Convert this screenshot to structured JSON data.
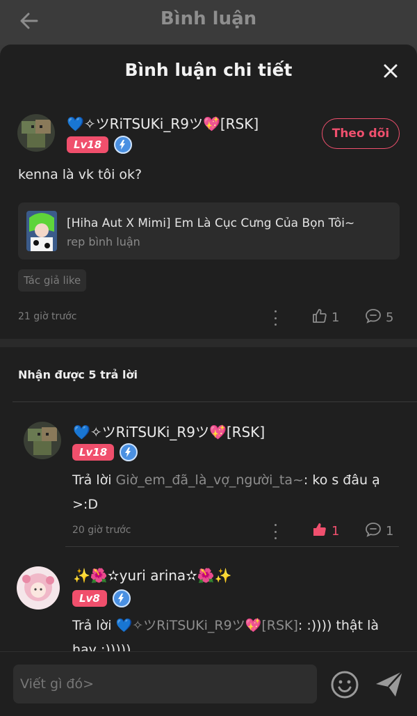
{
  "header": {
    "title": "Bình luận"
  },
  "sheet": {
    "title": "Bình luận chi tiết"
  },
  "comment": {
    "username": "💙✧ツRiTSUKi_R9ツ💖[RSK]",
    "level": "Lv18",
    "follow_label": "Theo dõi",
    "text": "kenna là vk tôi ok?",
    "ref": {
      "title": "[Hiha Aut X Mimi] Em Là Cục Cưng Của Bọn Tôi~",
      "subtitle": "rep bình luận"
    },
    "tag": "Tác giả like",
    "time": "21 giờ trước",
    "likes": "1",
    "comments": "5"
  },
  "replies_header": "Nhận được 5 trả lời",
  "replies": [
    {
      "username": "💙✧ツRiTSUKi_R9ツ💖[RSK]",
      "level": "Lv18",
      "prefix": "Trả lời ",
      "mention": "Giờ_em_đã_là_vợ_người_ta~",
      "text": ": ko s đâu ạ",
      "text2": ">:D",
      "time": "20 giờ trước",
      "likes": "1",
      "comments": "1"
    },
    {
      "username": "✨🌺✫yuri arina✫🌺✨",
      "level": "Lv8",
      "prefix": "Trả lời ",
      "mention": "💙✧ツRiTSUKi_R9ツ💖[RSK]",
      "text": ": :)))) thật là",
      "text2": "hay :)))))"
    }
  ],
  "composer": {
    "placeholder": "Viết gì đó>"
  },
  "colors": {
    "accent": "#f0506e",
    "background": "#1f1f1f",
    "level_badge": "#f04f6c",
    "liked": "#f0506e"
  }
}
